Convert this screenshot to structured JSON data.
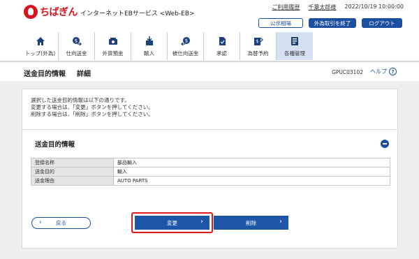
{
  "brand": {
    "logo_text": "ちばぎん",
    "service_name": "インターネットEBサービス <Web-EB>"
  },
  "header": {
    "usage_history": "ご利用履歴",
    "user_name": "千葉太郎様",
    "datetime": "2022/10/19 10:00:00",
    "buttons": {
      "public_rates": "公示相場",
      "end_fx": "外為取引を終了",
      "logout": "ログアウト"
    }
  },
  "nav": {
    "items": [
      {
        "label": "トップ(外為)",
        "icon": "home-icon"
      },
      {
        "label": "仕向送金",
        "icon": "remittance-out-icon"
      },
      {
        "label": "外貨預金",
        "icon": "deposit-icon"
      },
      {
        "label": "輸入",
        "icon": "import-icon"
      },
      {
        "label": "被仕向送金",
        "icon": "remittance-in-icon"
      },
      {
        "label": "承認",
        "icon": "approval-icon"
      },
      {
        "label": "為替予約",
        "icon": "forward-contract-icon"
      },
      {
        "label": "各種管理",
        "icon": "management-icon"
      }
    ],
    "active_index": 7
  },
  "page": {
    "title": "送金目的情報",
    "subtitle": "詳細",
    "code": "GPUC03102",
    "help_label": "ヘルプ",
    "help_icon": "?"
  },
  "message": {
    "lines": [
      "選択した送金目的情報は以下の通りです。",
      "変更する場合は、「変更」ボタンを押してください。",
      "削除する場合は、「削除」ボタンを押してください。"
    ]
  },
  "section": {
    "title": "送金目的情報",
    "rows": [
      {
        "label": "登録名称",
        "value": "部品輸入"
      },
      {
        "label": "送金目的",
        "value": "輸入"
      },
      {
        "label": "送金理由",
        "value": "AUTO PARTS"
      }
    ]
  },
  "actions": {
    "back": "戻る",
    "change": "変更",
    "delete": "削除"
  },
  "colors": {
    "brand_red": "#d7141b",
    "primary_blue": "#1d56a8",
    "highlight_red": "#e11a1a",
    "active_tab": "#d6e2f3"
  }
}
